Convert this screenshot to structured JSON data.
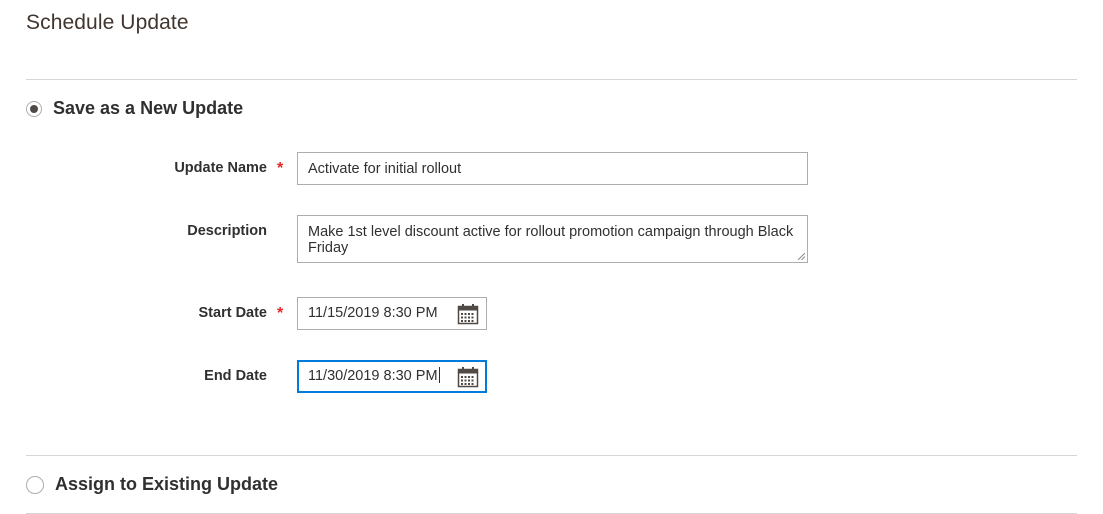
{
  "page": {
    "title": "Schedule Update"
  },
  "options": {
    "new_update": {
      "label": "Save as a New Update",
      "selected": true
    },
    "existing_update": {
      "label": "Assign to Existing Update",
      "selected": false
    }
  },
  "form": {
    "update_name": {
      "label": "Update Name",
      "required_mark": "*",
      "value": "Activate for initial rollout"
    },
    "description": {
      "label": "Description",
      "value": "Make 1st level discount active for rollout promotion campaign through Black Friday"
    },
    "start_date": {
      "label": "Start Date",
      "required_mark": "*",
      "value": "11/15/2019 8:30 PM",
      "icon": "calendar-icon"
    },
    "end_date": {
      "label": "End Date",
      "value": "11/30/2019 8:30 PM",
      "icon": "calendar-icon"
    }
  },
  "colors": {
    "required": "#e22626",
    "focus_border": "#007bdb",
    "text": "#303030",
    "divider": "#d6d6d6"
  }
}
